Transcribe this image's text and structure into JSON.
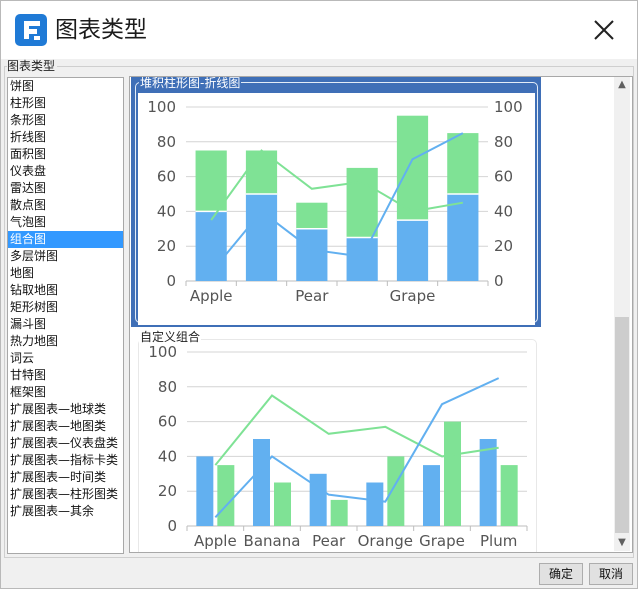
{
  "dialog": {
    "title": "图表类型",
    "group_label": "图表类型"
  },
  "chart_types": [
    "饼图",
    "柱形图",
    "条形图",
    "折线图",
    "面积图",
    "仪表盘",
    "雷达图",
    "散点图",
    "气泡图",
    "组合图",
    "多层饼图",
    "地图",
    "钻取地图",
    "矩形树图",
    "漏斗图",
    "热力地图",
    "词云",
    "甘特图",
    "框架图",
    "扩展图表—地球类",
    "扩展图表—地图类",
    "扩展图表—仪表盘类",
    "扩展图表—指标卡类",
    "扩展图表—时间类",
    "扩展图表—柱形图类",
    "扩展图表—其余"
  ],
  "selected_type": "组合图",
  "colors": {
    "selection": "#3399ff",
    "card_selected": "#3f6fb7",
    "bar_blue": "#62b0f0",
    "bar_green": "#7fe295",
    "line_green": "#7fe295",
    "line_blue": "#62b0f0"
  },
  "previews": [
    {
      "title": "堆积柱形图-折线图",
      "selected": true
    },
    {
      "title": "自定义组合",
      "selected": false
    }
  ],
  "chart_data": [
    {
      "type": "bar",
      "subtype": "stacked-bar-with-lines",
      "categories": [
        "Apple",
        "Banana",
        "Pear",
        "Orange",
        "Grape",
        "Plum"
      ],
      "visible_x_tick_labels": [
        "Apple",
        "Pear",
        "Grape"
      ],
      "series": [
        {
          "values": [
            40,
            50,
            30,
            25,
            35,
            50
          ]
        },
        {
          "values": [
            35,
            25,
            15,
            40,
            60,
            35
          ]
        }
      ],
      "lines": [
        {
          "values": [
            35,
            75,
            53,
            57,
            40,
            45
          ]
        },
        {
          "values": [
            5,
            40,
            18,
            14,
            70,
            85
          ]
        }
      ],
      "y_ticks": [
        0,
        20,
        40,
        60,
        80,
        100
      ],
      "y2_ticks": [
        0,
        20,
        40,
        60,
        80,
        100
      ],
      "ylim": [
        0,
        100
      ],
      "grid": true
    },
    {
      "type": "bar",
      "subtype": "grouped-bar-with-lines",
      "categories": [
        "Apple",
        "Banana",
        "Pear",
        "Orange",
        "Grape",
        "Plum"
      ],
      "series": [
        {
          "values": [
            40,
            50,
            30,
            25,
            35,
            50
          ]
        },
        {
          "values": [
            35,
            25,
            15,
            40,
            60,
            35
          ]
        }
      ],
      "lines": [
        {
          "values": [
            35,
            75,
            53,
            57,
            40,
            45
          ]
        },
        {
          "values": [
            5,
            40,
            18,
            14,
            70,
            85
          ]
        }
      ],
      "y_ticks": [
        0,
        20,
        40,
        60,
        80,
        100
      ],
      "ylim": [
        0,
        100
      ],
      "grid": true
    }
  ],
  "buttons": {
    "ok": "确定",
    "cancel": "取消"
  },
  "icons": {
    "logo": "app-logo-icon",
    "close": "close-icon",
    "scroll_up": "scroll-up-arrow-icon",
    "scroll_down": "scroll-down-arrow-icon"
  }
}
